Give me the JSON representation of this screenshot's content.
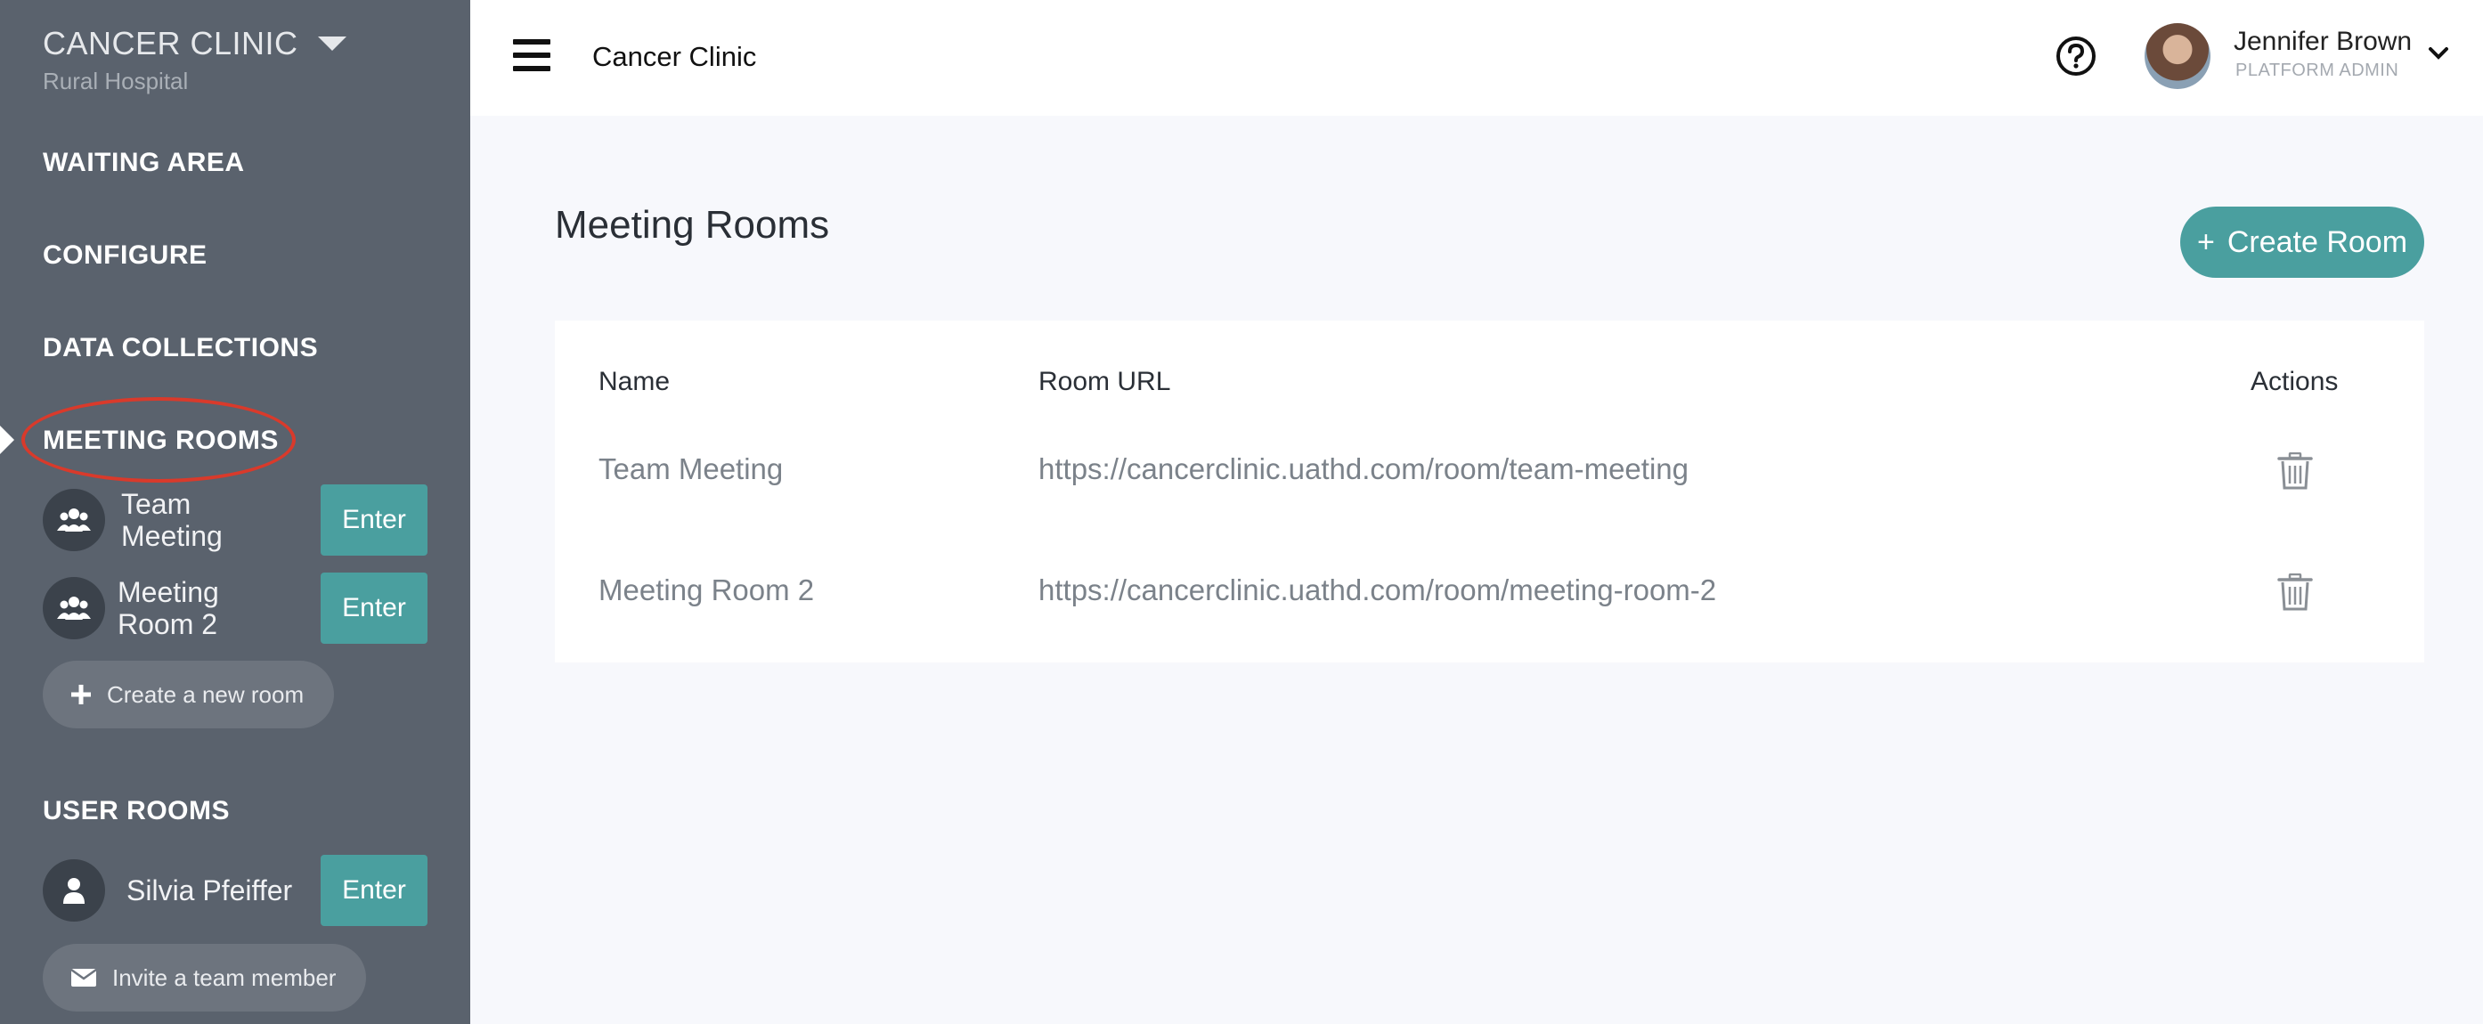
{
  "sidebar": {
    "clinic_name": "CANCER CLINIC",
    "clinic_subtitle": "Rural Hospital",
    "nav": {
      "waiting_area": "WAITING AREA",
      "configure": "CONFIGURE",
      "data_collections": "DATA COLLECTIONS",
      "meeting_rooms": "MEETING ROOMS",
      "user_rooms": "USER ROOMS"
    },
    "meeting_rooms": [
      {
        "label": "Team Meeting",
        "enter": "Enter",
        "icon": "group-icon"
      },
      {
        "label": "Meeting Room 2",
        "enter": "Enter",
        "icon": "group-icon"
      }
    ],
    "create_room_label": "Create a new room",
    "user_rooms": [
      {
        "label": "Silvia Pfeiffer",
        "enter": "Enter",
        "icon": "user-icon"
      }
    ],
    "invite_label": "Invite a team member"
  },
  "topbar": {
    "title": "Cancer Clinic",
    "user_name": "Jennifer Brown",
    "user_role": "PLATFORM ADMIN"
  },
  "main": {
    "page_title": "Meeting Rooms",
    "create_button": "Create Room",
    "columns": {
      "name": "Name",
      "url": "Room URL",
      "actions": "Actions"
    },
    "rows": [
      {
        "name": "Team Meeting",
        "url": "https://cancerclinic.uathd.com/room/team-meeting"
      },
      {
        "name": "Meeting Room 2",
        "url": "https://cancerclinic.uathd.com/room/meeting-room-2"
      }
    ]
  },
  "colors": {
    "sidebar_bg": "#5a626d",
    "accent_teal": "#4a9f9f",
    "highlight_red": "#d93a2b",
    "content_bg": "#f7f8fc"
  }
}
